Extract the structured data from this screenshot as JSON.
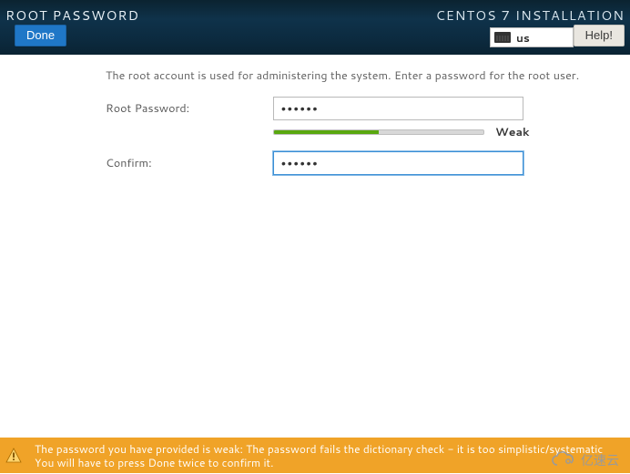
{
  "header": {
    "page_title": "ROOT PASSWORD",
    "installer_title": "CENTOS 7 INSTALLATION",
    "done_label": "Done",
    "help_label": "Help!",
    "keyboard_layout": "us"
  },
  "form": {
    "description": "The root account is used for administering the system.  Enter a password for the root user.",
    "password_label": "Root Password:",
    "password_value": "••••••",
    "confirm_label": "Confirm:",
    "confirm_value": "••••••",
    "strength_label": "Weak",
    "strength_fraction": 0.5
  },
  "warning": {
    "text": "The password you have provided is weak: The password fails the dictionary check - it is too simplistic/systematic You will have to press Done twice to confirm it."
  },
  "watermark": {
    "text": "亿速云"
  },
  "colors": {
    "accent_blue": "#1f77c7",
    "strength_green": "#59a80f",
    "warning_orange": "#f0a328"
  }
}
